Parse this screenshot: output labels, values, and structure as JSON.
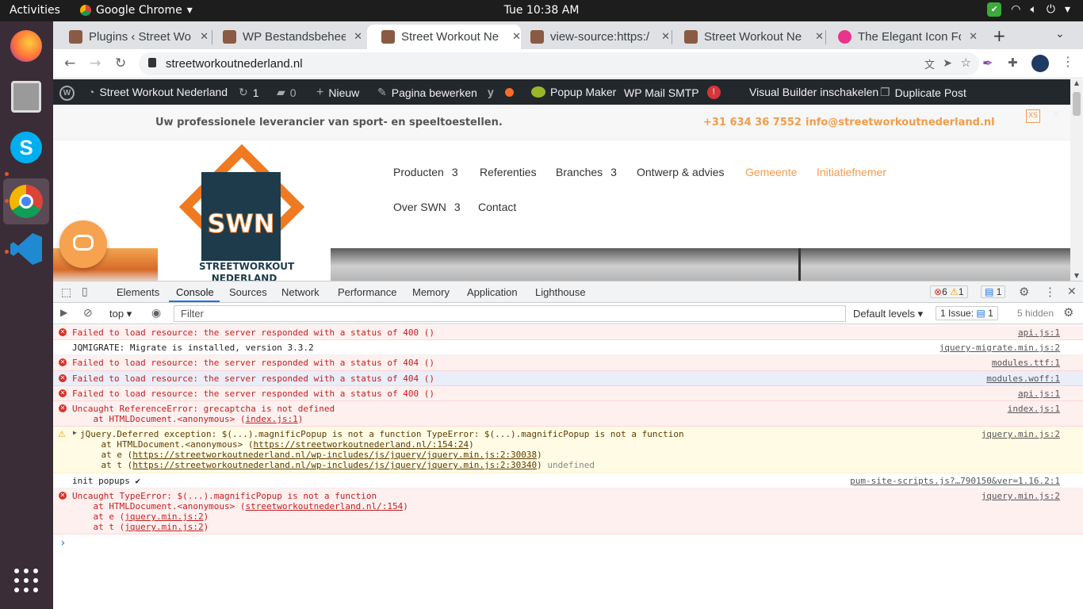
{
  "topbar": {
    "activities": "Activities",
    "app": "Google Chrome",
    "clock": "Tue 10:38 AM"
  },
  "tabs": [
    {
      "title": "Plugins ‹ Street Wo",
      "color": "#8a5a44"
    },
    {
      "title": "WP Bestandsbehee",
      "color": "#8a5a44"
    },
    {
      "title": "Street Workout Ne",
      "color": "#8a5a44"
    },
    {
      "title": "view-source:https:/",
      "color": "#8a5a44"
    },
    {
      "title": "Street Workout Ne",
      "color": "#8a5a44"
    },
    {
      "title": "The Elegant Icon Fo",
      "color": "#e8348a"
    }
  ],
  "omnibox": {
    "url": "streetworkoutnederland.nl"
  },
  "wpbar": {
    "site": "Street Workout Nederland",
    "updates": "1",
    "comments": "0",
    "new": "Nieuw",
    "edit": "Pagina bewerken",
    "popup": "Popup Maker",
    "smtp": "WP Mail SMTP",
    "smtp_badge": "!",
    "visual": "Visual Builder inschakelen",
    "duplicate": "Duplicate Post"
  },
  "site": {
    "tagline": "Uw professionele leverancier van sport- en speeltoestellen.",
    "phone": "+31 634 36 7552",
    "email": "info@streetworkoutnederland.nl",
    "xs": "XS",
    "logo_text": "SWN",
    "logo_sub": "STREETWORKOUT",
    "logo_sub2": "NEDERLAND",
    "menu": {
      "producten": "Producten",
      "referenties": "Referenties",
      "branches": "Branches",
      "ontwerp": "Ontwerp & advies",
      "gemeente": "Gemeente",
      "initiatief": "Initiatiefnemer",
      "over": "Over SWN",
      "contact": "Contact",
      "arrow": "3"
    }
  },
  "devtools": {
    "tabs": [
      "Elements",
      "Console",
      "Sources",
      "Network",
      "Performance",
      "Memory",
      "Application",
      "Lighthouse"
    ],
    "errors": "6",
    "warnings": "1",
    "messages": "1",
    "context": "top",
    "filter": "Filter",
    "levels": "Default levels",
    "issues": "1 Issue:",
    "issues_count": "1",
    "hidden": "5 hidden"
  },
  "console": [
    {
      "msg": "Failed to load resource: the server responded with a status of 400 ()",
      "src": "api.js:1"
    },
    {
      "msg": "JQMIGRATE: Migrate is installed, version 3.3.2",
      "src": "jquery-migrate.min.js:2"
    },
    {
      "msg": "Failed to load resource: the server responded with a status of 404 ()",
      "src": "modules.ttf:1"
    },
    {
      "msg": "Failed to load resource: the server responded with a status of 404 ()",
      "src": "modules.woff:1"
    },
    {
      "msg": "Failed to load resource: the server responded with a status of 400 ()",
      "src": "api.js:1"
    },
    {
      "msg": "Uncaught ReferenceError: grecaptcha is not defined",
      "l2a": "    at HTMLDocument.<anonymous> (",
      "l2b": "index.js:1",
      "l2c": ")",
      "src": "index.js:1"
    },
    {
      "msg": "jQuery.Deferred exception: $(...).magnificPopup is not a function TypeError: $(...).magnificPopup is not a function",
      "l2a": "    at HTMLDocument.<anonymous> (",
      "l2b": "https://streetworkoutnederland.nl/:154:24",
      "l2c": ")",
      "l3a": "    at e (",
      "l3b": "https://streetworkoutnederland.nl/wp-includes/js/jquery/jquery.min.js:2:30038",
      "l3c": ")",
      "l4a": "    at t (",
      "l4b": "https://streetworkoutnederland.nl/wp-includes/js/jquery/jquery.min.js:2:30340",
      "l4c": ") ",
      "l4d": "undefined",
      "src": "jquery.min.js:2"
    },
    {
      "msg": "init popups ✔",
      "src": "pum-site-scripts.js?…790150&ver=1.16.2:1"
    },
    {
      "msg": "Uncaught TypeError: $(...).magnificPopup is not a function",
      "l2a": "    at HTMLDocument.<anonymous> (",
      "l2b": "streetworkoutnederland.nl/:154",
      "l2c": ")",
      "l3a": "    at e (",
      "l3b": "jquery.min.js:2",
      "l3c": ")",
      "l4a": "    at t (",
      "l4b": "jquery.min.js:2",
      "l4c": ")",
      "src": "jquery.min.js:2"
    }
  ],
  "prompt": "›"
}
